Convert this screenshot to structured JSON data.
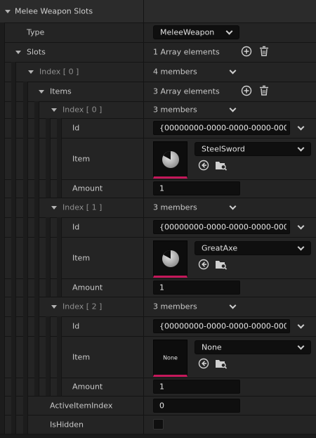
{
  "header": {
    "title": "Melee Weapon Slots"
  },
  "type_row": {
    "label": "Type",
    "value": "MeleeWeapon"
  },
  "slots": {
    "label": "Slots",
    "summary": "1 Array elements"
  },
  "index0": {
    "label": "Index [ 0 ]",
    "summary": "4 members"
  },
  "items": {
    "label": "Items",
    "summary": "3 Array elements"
  },
  "entries": [
    {
      "index_label": "Index [ 0 ]",
      "members": "3 members",
      "id_label": "Id",
      "id_value": "{00000000-0000-0000-0000-00000",
      "item_label": "Item",
      "asset": "SteelSword",
      "thumb": "weapon",
      "amount_label": "Amount",
      "amount": "1"
    },
    {
      "index_label": "Index [ 1 ]",
      "members": "3 members",
      "id_label": "Id",
      "id_value": "{00000000-0000-0000-0000-00000",
      "item_label": "Item",
      "asset": "GreatAxe",
      "thumb": "weapon",
      "amount_label": "Amount",
      "amount": "1"
    },
    {
      "index_label": "Index [ 2 ]",
      "members": "3 members",
      "id_label": "Id",
      "id_value": "{00000000-0000-0000-0000-00000",
      "item_label": "Item",
      "asset": "None",
      "thumb_text": "None",
      "amount_label": "Amount",
      "amount": "1"
    }
  ],
  "active_item_index": {
    "label": "ActiveItemIndex",
    "value": "0"
  },
  "is_hidden": {
    "label": "IsHidden",
    "checked": false
  },
  "icons": {
    "add": "add-element-icon",
    "delete": "trash-icon",
    "use_selected": "use-selected-asset-icon",
    "browse": "browse-asset-icon",
    "thumbnail": "pie-thumbnail-icon"
  },
  "colors": {
    "background": "#242424",
    "field": "#0f0f0f",
    "accent": "#c4185a",
    "text": "#c8c8c8",
    "dim_text": "#8f8f8f"
  }
}
